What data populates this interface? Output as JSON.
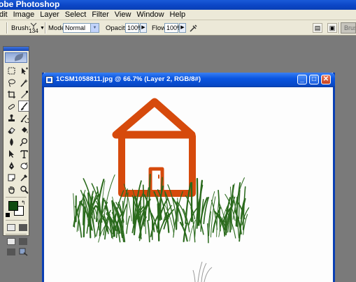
{
  "app": {
    "title_partial": "obe Photoshop",
    "accent_color": "#0a3fb4"
  },
  "menu": {
    "items": [
      "dit",
      "Image",
      "Layer",
      "Select",
      "Filter",
      "View",
      "Window",
      "Help"
    ]
  },
  "options_bar": {
    "brush_label": "Brush:",
    "brush_size": "134",
    "mode_label": "Mode:",
    "mode_value": "Normal",
    "opacity_label": "Opacity:",
    "opacity_value": "100%",
    "flow_label": "Flow:",
    "flow_value": "100%",
    "palette_well_label": "Brush"
  },
  "toolbox": {
    "foreground_color": "#0f4a10",
    "background_color": "#ffffff",
    "tools": [
      "marquee-icon",
      "move-icon",
      "lasso-icon",
      "magic-wand-icon",
      "crop-icon",
      "slice-icon",
      "healing-brush-icon",
      "brush-icon",
      "clone-stamp-icon",
      "history-brush-icon",
      "eraser-icon",
      "paint-bucket-icon",
      "blur-icon",
      "dodge-icon",
      "path-selection-icon",
      "type-icon",
      "pen-icon",
      "shape-icon",
      "notes-icon",
      "eyedropper-icon",
      "hand-icon",
      "zoom-icon"
    ],
    "active_tool": "brush-icon"
  },
  "document": {
    "title": "1CSM1058811.jpg @ 66.7% (Layer 2, RGB/8#)",
    "house_color": "#d64a0c",
    "grass_color": "#2a6a1c"
  }
}
